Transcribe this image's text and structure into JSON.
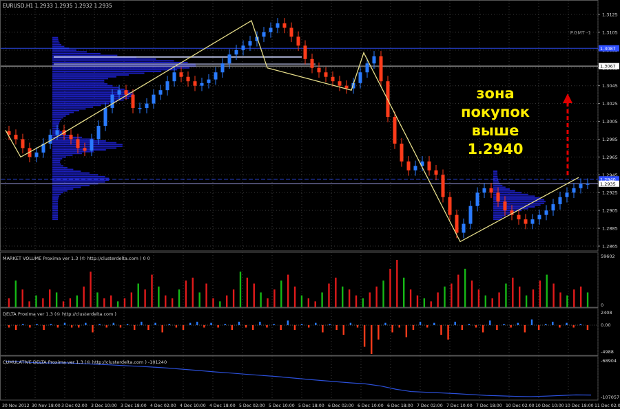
{
  "main_panel": {
    "header": "EURUSD,H1  1.2933 1.2935 1.2932 1.2935",
    "pgmt": "P.GMT -1",
    "annotation": [
      "зона",
      "покупок",
      "выше",
      "1.2940"
    ],
    "price_ticks": [
      "1.3125",
      "1.3105",
      "1.3085",
      "1.3065",
      "1.3045",
      "1.3025",
      "1.3005",
      "1.2985",
      "1.2965",
      "1.2945",
      "1.2925",
      "1.2905",
      "1.2885",
      "1.2865"
    ],
    "badges": [
      {
        "label": "1.3087",
        "price": 1.3087,
        "color": "#3050ff"
      },
      {
        "label": "1.3067",
        "price": 1.3067,
        "color": "#ffffff"
      },
      {
        "label": "1.2940",
        "price": 1.294,
        "color": "#3050ff"
      },
      {
        "label": "1.2935",
        "price": 1.2935,
        "color": "#ffffff"
      }
    ],
    "close_series": [
      1.299,
      1.2985,
      1.2975,
      1.2965,
      1.297,
      1.298,
      1.299,
      1.2995,
      1.299,
      1.2985,
      1.2975,
      1.2972,
      1.2985,
      1.3,
      1.302,
      1.3035,
      1.304,
      1.3035,
      1.302,
      1.302,
      1.3025,
      1.3035,
      1.304,
      1.305,
      1.306,
      1.3055,
      1.305,
      1.3045,
      1.3048,
      1.3052,
      1.306,
      1.307,
      1.308,
      1.3085,
      1.309,
      1.3095,
      1.31,
      1.3105,
      1.311,
      1.3115,
      1.311,
      1.31,
      1.309,
      1.3075,
      1.3065,
      1.306,
      1.3055,
      1.305,
      1.3045,
      1.3042,
      1.3048,
      1.306,
      1.307,
      1.3078,
      1.305,
      1.301,
      1.298,
      1.296,
      1.295,
      1.2955,
      1.296,
      1.295,
      1.2945,
      1.292,
      1.29,
      1.288,
      1.289,
      1.291,
      1.2925,
      1.293,
      1.2925,
      1.2915,
      1.2905,
      1.29,
      1.2895,
      1.289,
      1.2895,
      1.29,
      1.2905,
      1.2912,
      1.292,
      1.2925,
      1.293,
      1.2935,
      1.2935
    ]
  },
  "zigzag_prices": [
    1.2995,
    1.2965,
    1.2985,
    1.3118,
    1.3065,
    1.304,
    1.3082,
    1.287,
    1.2942
  ],
  "volume_panel": {
    "label": "MARKET VOLUME Proxima ver 1.3 (© http://clusterdelta.com ) 0 0",
    "ticks": [
      "59602",
      "0"
    ],
    "bars": [
      3,
      9,
      6,
      2,
      4,
      3,
      6,
      5,
      2,
      3,
      4,
      7,
      12,
      5,
      3,
      4,
      2,
      3,
      5,
      8,
      6,
      11,
      7,
      4,
      3,
      6,
      9,
      10,
      5,
      8,
      3,
      2,
      4,
      6,
      12,
      10,
      8,
      5,
      3,
      6,
      9,
      11,
      7,
      4,
      3,
      2,
      5,
      8,
      10,
      7,
      6,
      4,
      3,
      5,
      7,
      9,
      13,
      16,
      10,
      6,
      4,
      3,
      2,
      5,
      7,
      8,
      11,
      13,
      9,
      6,
      4,
      3,
      5,
      8,
      10,
      7,
      4,
      6,
      9,
      11,
      8,
      5,
      4,
      6,
      7,
      5
    ]
  },
  "delta_panel": {
    "label": "DELTA Proxima ver 1.3 (© http://clusterdelta.com )",
    "ticks": [
      "2408",
      "0.00",
      "-4988"
    ],
    "bars": [
      -1,
      -2,
      1,
      -1,
      1,
      -2,
      1,
      -1,
      2,
      -1,
      -1,
      2,
      -3,
      1,
      -1,
      2,
      -1,
      1,
      -2,
      3,
      -2,
      2,
      -3,
      1,
      -1,
      -2,
      2,
      3,
      -1,
      2,
      -1,
      1,
      -2,
      3,
      -1,
      -2,
      3,
      -1,
      1,
      -2,
      4,
      -2,
      1,
      -1,
      2,
      -3,
      1,
      -2,
      -4,
      2,
      -1,
      -9,
      -12,
      -6,
      2,
      -3,
      -1,
      -5,
      -2,
      3,
      -1,
      2,
      -4,
      -6,
      3,
      -2,
      1,
      -1,
      -3,
      4,
      -2,
      1,
      -1,
      2,
      -3,
      5,
      -2,
      1,
      3,
      -1,
      2,
      -1,
      1,
      -2
    ]
  },
  "cumdelta_panel": {
    "label": "CUMULATIVE DELTA Proxima ver 1.3 (© http://clusterdelta.com ) -101240",
    "ticks": [
      "-68904",
      "-107057"
    ],
    "values": [
      -68904,
      -69200,
      -70100,
      -70500,
      -70300,
      -71000,
      -71800,
      -72500,
      -73400,
      -74200,
      -75100,
      -76200,
      -77500,
      -78800,
      -80200,
      -81400,
      -82700,
      -83900,
      -85100,
      -86600,
      -88100,
      -89500,
      -90800,
      -92100,
      -93200,
      -95500,
      -99000,
      -101500,
      -102300,
      -103000,
      -103800,
      -104800,
      -105700,
      -106200,
      -106800,
      -107057,
      -106500,
      -105800,
      -105200,
      -105400
    ]
  },
  "time_axis": [
    "30 Nov 2012",
    "30 Nov 18:00",
    "3 Dec 02:00",
    "3 Dec 10:00",
    "3 Dec 18:00",
    "4 Dec 02:00",
    "4 Dec 10:00",
    "4 Dec 18:00",
    "5 Dec 02:00",
    "5 Dec 10:00",
    "5 Dec 18:00",
    "6 Dec 02:00",
    "6 Dec 10:00",
    "6 Dec 18:00",
    "7 Dec 02:00",
    "7 Dec 10:00",
    "7 Dec 18:00",
    "10 Dec 02:00",
    "10 Dec 10:00",
    "10 Dec 18:00",
    "11 Dec 02:00"
  ],
  "colors": {
    "bull": "#2a7bff",
    "bear": "#ff3b1a",
    "vol_green": "#16b816",
    "vol_red": "#e01a1a",
    "zigzag": "#e6dd8a",
    "profile": "#1e22d6",
    "annot": "#ffee00",
    "arrow": "#e00000",
    "grid": "#2a2a2a",
    "text": "#d8d8d8",
    "cum": "#2b4fd8"
  }
}
